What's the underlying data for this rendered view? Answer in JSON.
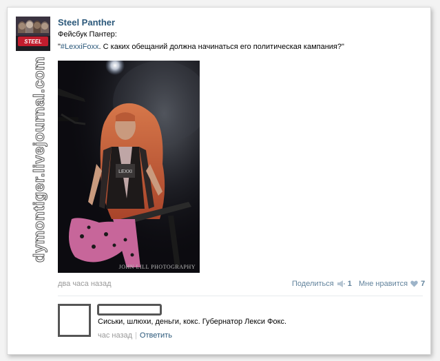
{
  "post": {
    "author": "Steel Panther",
    "line1": "Фейсбук Пантер:",
    "quote_open": "\"",
    "hashtag": "#LexxiFoxx",
    "line2_text": ". С каких обещаний должна начинаться его политическая кампания?\"",
    "photo_credit": "JOHN LILL PHOTOGRAPHY",
    "time": "два часа назад",
    "share_label": "Поделиться",
    "share_count": "1",
    "like_label": "Мне нравится",
    "like_count": "7"
  },
  "comment": {
    "text": "Сиськи, шлюхи, деньги, кокс. Губернатор Лекси Фокс.",
    "time": "час назад",
    "separator": "|",
    "reply_label": "Ответить"
  },
  "watermark": "dymontiger.livejournal.com",
  "icons": {
    "share": "megaphone-icon",
    "like": "heart-icon"
  },
  "colors": {
    "link": "#2b587a",
    "muted": "#999999"
  }
}
